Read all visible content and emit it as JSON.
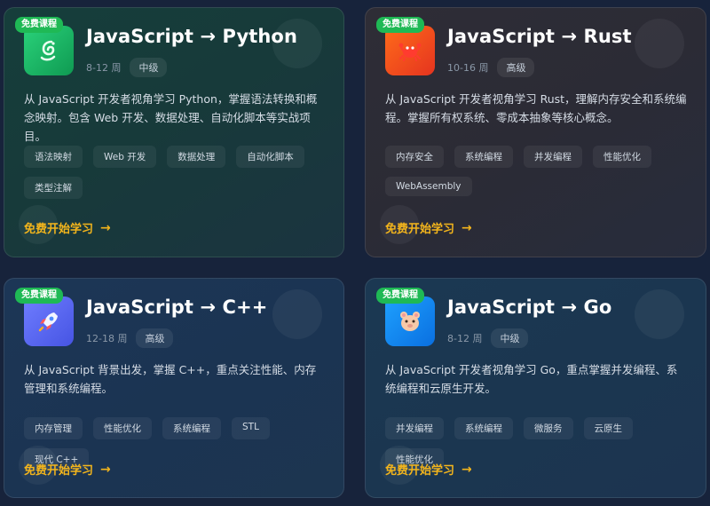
{
  "cards": [
    {
      "badge": "免费课程",
      "title": "JavaScript → Python",
      "weeks": "8-12 周",
      "level": "中级",
      "description": "从 JavaScript 开发者视角学习 Python，掌握语法转换和概念映射。包含 Web 开发、数据处理、自动化脚本等实战项目。",
      "tags": [
        "语法映射",
        "Web 开发",
        "数据处理",
        "自动化脚本",
        "类型注解"
      ],
      "cta": "免费开始学习",
      "cta_arrow": "→",
      "icon": "python-icon"
    },
    {
      "badge": "免费课程",
      "title": "JavaScript → Rust",
      "weeks": "10-16 周",
      "level": "高级",
      "description": "从 JavaScript 开发者视角学习 Rust，理解内存安全和系统编程。掌握所有权系统、零成本抽象等核心概念。",
      "tags": [
        "内存安全",
        "系统编程",
        "并发编程",
        "性能优化",
        "WebAssembly"
      ],
      "cta": "免费开始学习",
      "cta_arrow": "→",
      "icon": "crab-icon"
    },
    {
      "badge": "免费课程",
      "title": "JavaScript → C++",
      "weeks": "12-18 周",
      "level": "高级",
      "description": "从 JavaScript 背景出发，掌握 C++，重点关注性能、内存管理和系统编程。",
      "tags": [
        "内存管理",
        "性能优化",
        "系统编程",
        "STL",
        "现代 C++"
      ],
      "cta": "免费开始学习",
      "cta_arrow": "→",
      "icon": "rocket-icon"
    },
    {
      "badge": "免费课程",
      "title": "JavaScript → Go",
      "weeks": "8-12 周",
      "level": "中级",
      "description": "从 JavaScript 开发者视角学习 Go，重点掌握并发编程、系统编程和云原生开发。",
      "tags": [
        "并发编程",
        "系统编程",
        "微服务",
        "云原生",
        "性能优化"
      ],
      "cta": "免费开始学习",
      "cta_arrow": "→",
      "icon": "gopher-icon"
    }
  ]
}
